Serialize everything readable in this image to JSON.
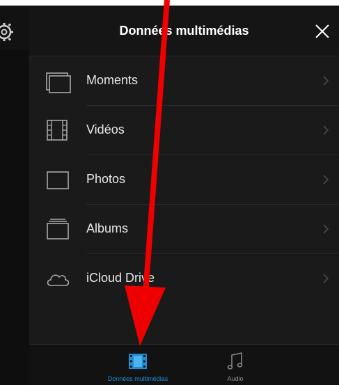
{
  "header": {
    "title": "Données multimédias"
  },
  "rows": [
    {
      "label": "Moments"
    },
    {
      "label": "Vidéos"
    },
    {
      "label": "Photos"
    },
    {
      "label": "Albums"
    },
    {
      "label": "iCloud Drive"
    }
  ],
  "tabs": [
    {
      "label": "Données multimédias",
      "active": true,
      "icon": "film-icon"
    },
    {
      "label": "Audio",
      "active": false,
      "icon": "music-note-icon"
    }
  ],
  "colors": {
    "accent": "#1e8fd6",
    "annotation_arrow": "#ee0000",
    "inactive_tab": "#8e8e8e"
  }
}
